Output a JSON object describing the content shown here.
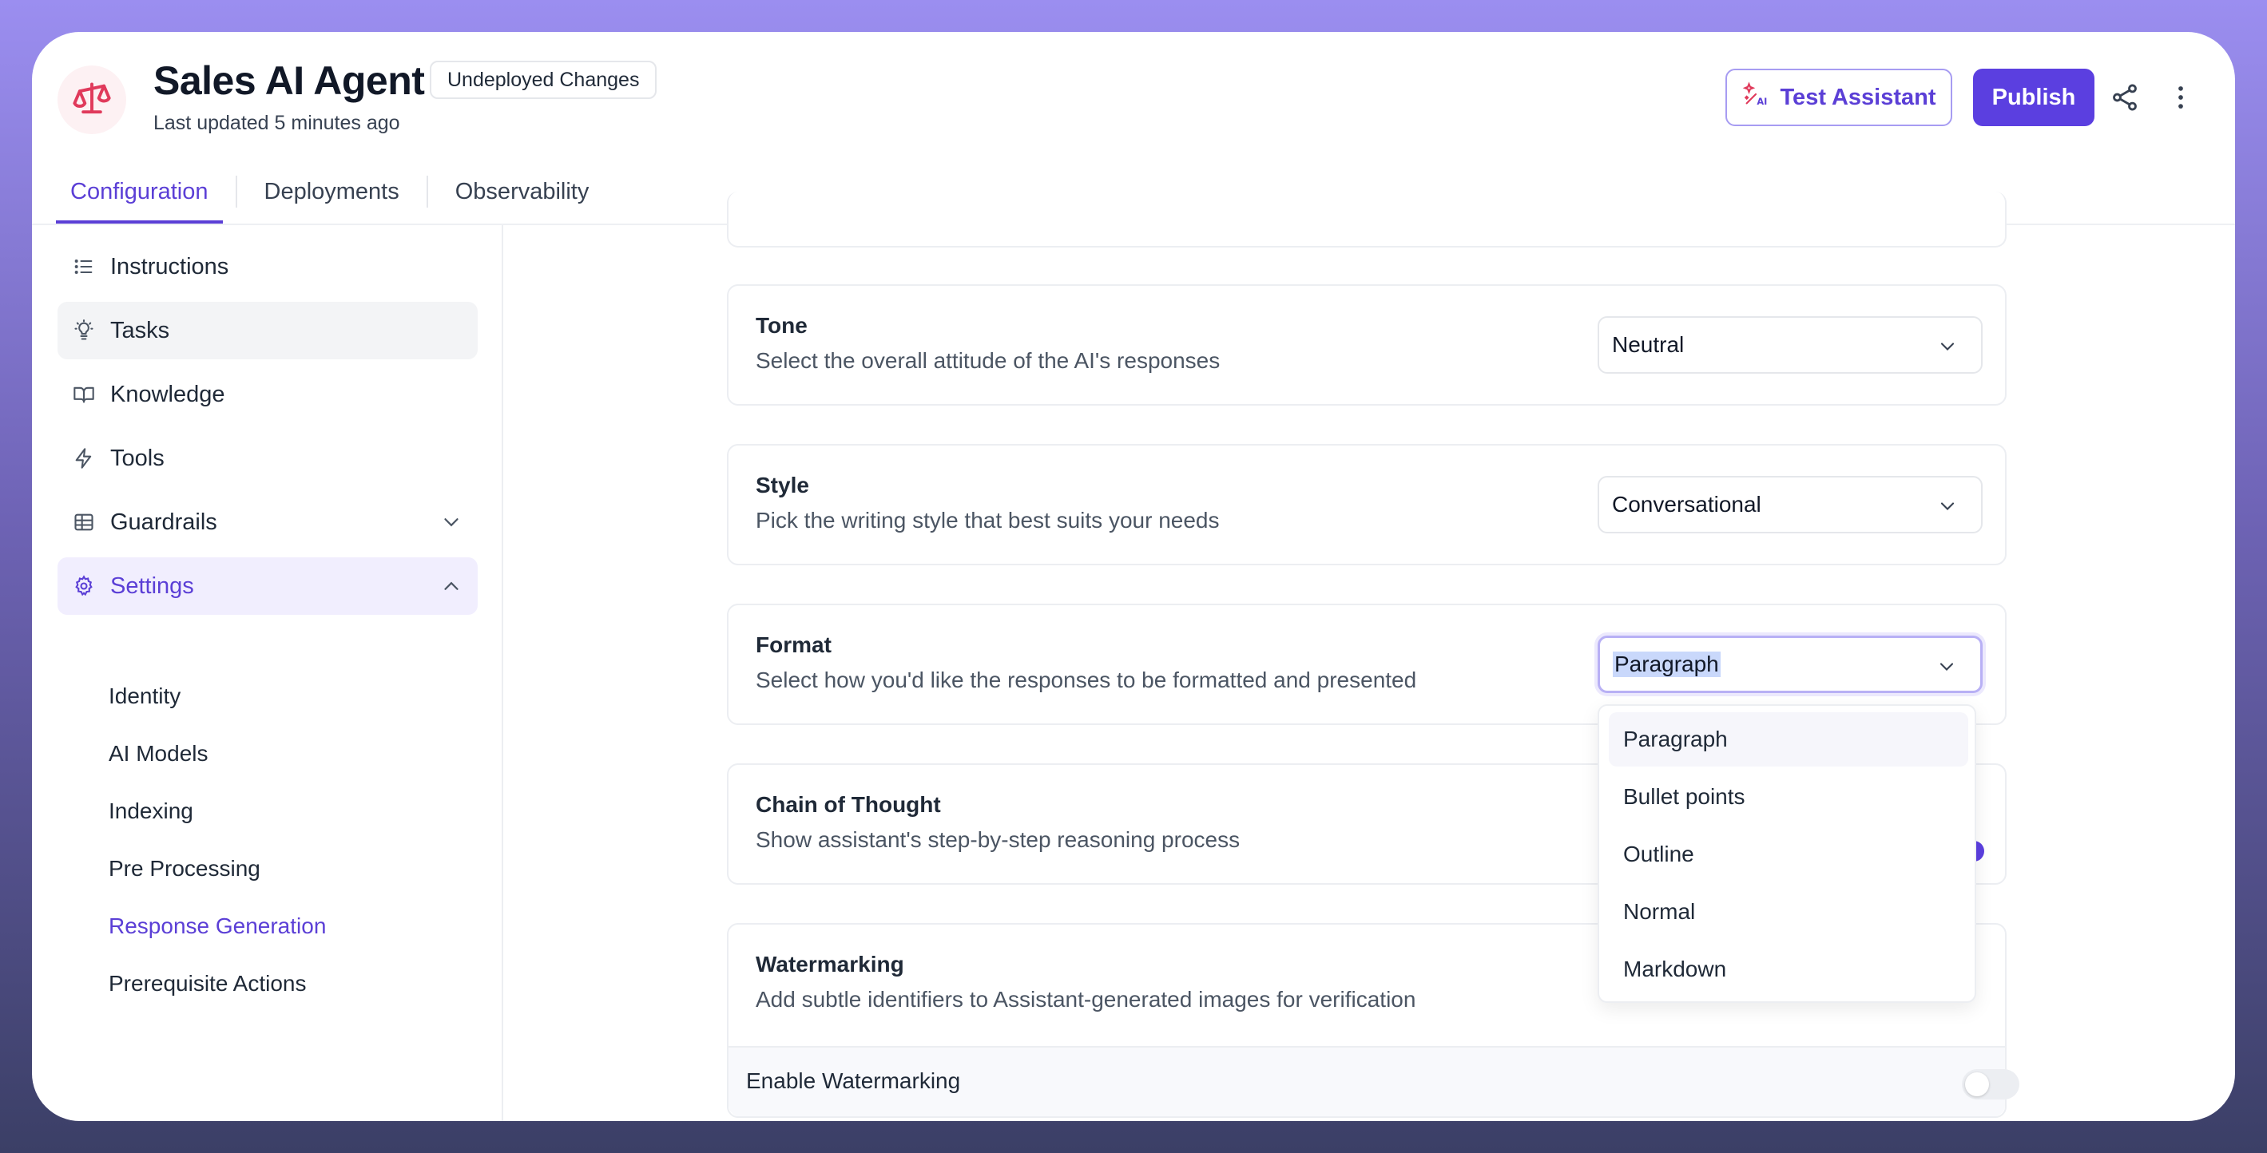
{
  "header": {
    "title": "Sales AI Agent",
    "badge": "Undeployed Changes",
    "subtitle": "Last updated 5 minutes ago",
    "test_button": "Test Assistant",
    "publish_button": "Publish"
  },
  "tabs": [
    {
      "label": "Configuration",
      "active": true
    },
    {
      "label": "Deployments"
    },
    {
      "label": "Observability"
    }
  ],
  "sidebar": {
    "items": [
      {
        "label": "Instructions",
        "icon": "list-icon"
      },
      {
        "label": "Tasks",
        "icon": "lightbulb-icon"
      },
      {
        "label": "Knowledge",
        "icon": "book-icon"
      },
      {
        "label": "Tools",
        "icon": "lightning-icon"
      },
      {
        "label": "Guardrails",
        "icon": "table-icon"
      },
      {
        "label": "Settings",
        "icon": "gear-icon"
      }
    ],
    "settings_sub": [
      {
        "label": "Identity"
      },
      {
        "label": "AI Models"
      },
      {
        "label": "Indexing"
      },
      {
        "label": "Pre Processing"
      },
      {
        "label": "Response Generation",
        "active": true
      },
      {
        "label": "Prerequisite Actions"
      }
    ]
  },
  "settings": {
    "tone": {
      "title": "Tone",
      "description": "Select the overall attitude of the AI's responses",
      "value": "Neutral"
    },
    "style": {
      "title": "Style",
      "description": "Pick the writing style that best suits your needs",
      "value": "Conversational"
    },
    "format": {
      "title": "Format",
      "description": "Select how you'd like the responses to be formatted and presented",
      "value": "Paragraph",
      "options": [
        "Paragraph",
        "Bullet points",
        "Outline",
        "Normal",
        "Markdown"
      ]
    },
    "chain_of_thought": {
      "title": "Chain of Thought",
      "description": "Show assistant's step-by-step reasoning process"
    },
    "watermarking": {
      "title": "Watermarking",
      "description": "Add subtle identifiers to Assistant-generated images for verification",
      "toggle_label": "Enable Watermarking"
    }
  },
  "colors": {
    "accent": "#5b3fd6",
    "publish": "#5b3fe0",
    "logo": "#e03a5b"
  }
}
